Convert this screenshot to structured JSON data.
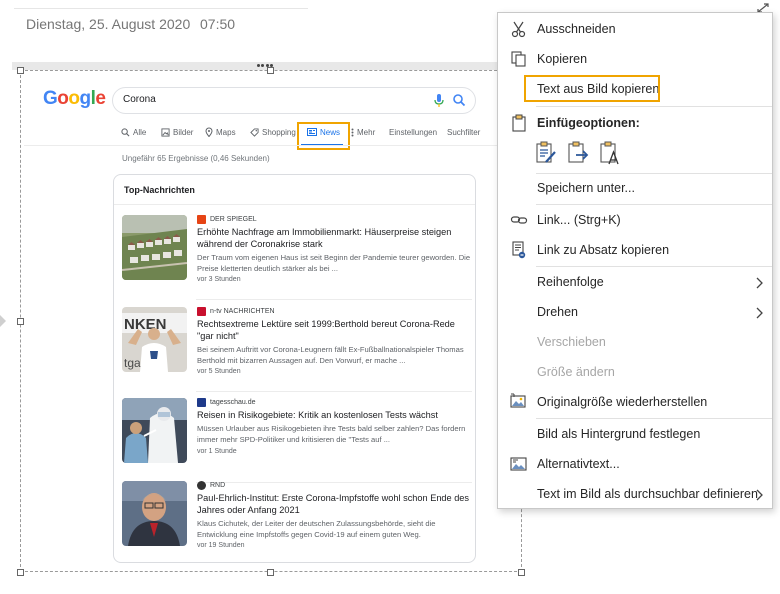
{
  "note": {
    "date": "Dienstag, 25. August 2020",
    "time": "07:50"
  },
  "google": {
    "logo_letters": [
      {
        "ch": "G",
        "color": "#4285F4"
      },
      {
        "ch": "o",
        "color": "#EA4335"
      },
      {
        "ch": "o",
        "color": "#FBBC05"
      },
      {
        "ch": "g",
        "color": "#4285F4"
      },
      {
        "ch": "l",
        "color": "#34A853"
      },
      {
        "ch": "e",
        "color": "#EA4335"
      }
    ],
    "query": "Corona",
    "tabs": [
      {
        "label": "Alle",
        "icon": "search-icon"
      },
      {
        "label": "Bilder",
        "icon": "image-icon"
      },
      {
        "label": "Maps",
        "icon": "pin-icon"
      },
      {
        "label": "Shopping",
        "icon": "tag-icon"
      },
      {
        "label": "News",
        "icon": "newspaper-icon",
        "active": true
      },
      {
        "label": "Mehr",
        "icon": "more-vert-icon"
      },
      {
        "label": "Einstellungen"
      },
      {
        "label": "Suchfilter"
      }
    ],
    "result_count": "Ungefähr 65 Ergebnisse (0,46 Sekunden)",
    "top_news": {
      "title": "Top-Nachrichten",
      "stories": [
        {
          "source": "DER SPIEGEL",
          "source_color": "#e64415",
          "headline": "Erhöhte Nachfrage am Immobilienmarkt: Häuserpreise steigen während der Coronakrise stark",
          "snippet": "Der Traum vom eigenen Haus ist seit Beginn der Pandemie teurer geworden. Die Preise kletterten deutlich stärker als bei ...",
          "age": "vor 3 Stunden"
        },
        {
          "source": "n-tv NACHRICHTEN",
          "source_color": "#c8102e",
          "headline": "Rechtsextreme Lektüre seit 1999:Berthold bereut Corona-Rede \"gar nicht\"",
          "snippet": "Bei seinem Auftritt vor Corona-Leugnern fällt Ex-Fußballnationalspieler Thomas Berthold mit bizarren Aussagen auf. Den Vorwurf, er mache ...",
          "age": "vor 5 Stunden"
        },
        {
          "source": "tagesschau.de",
          "source_color": "#1e3a8a",
          "headline": "Reisen in Risikogebiete: Kritik an kostenlosen Tests wächst",
          "snippet": "Müssen Urlauber aus Risikogebieten ihre Tests bald selber zahlen? Das fordern immer mehr SPD-Politiker und kritisieren die \"Tests auf ...",
          "age": "vor 1 Stunde"
        },
        {
          "source": "RND",
          "source_color": "#333333",
          "headline": "Paul-Ehrlich-Institut: Erste Corona-Impfstoffe wohl schon Ende des Jahres oder Anfang 2021",
          "snippet": "Klaus Cichutek, der Leiter der deutschen Zulassungsbehörde, sieht die Entwicklung eine Impfstoffs gegen Covid-19 auf einem guten Weg.",
          "age": "vor 19 Stunden"
        }
      ]
    }
  },
  "context_menu": {
    "cut": "Ausschneiden",
    "copy": "Kopieren",
    "copy_text": "Text aus Bild kopieren",
    "paste_options": "Einfügeoptionen:",
    "save_as": "Speichern unter...",
    "link": "Link... (Strg+K)",
    "copy_paragraph_link": "Link zu Absatz kopieren",
    "order": "Reihenfolge",
    "rotate": "Drehen",
    "move": "Verschieben",
    "resize": "Größe ändern",
    "restore_size": "Originalgröße wiederherstellen",
    "set_background": "Bild als Hintergrund festlegen",
    "alt_text": "Alternativtext...",
    "make_searchable": "Text im Bild als durchsuchbar definieren"
  },
  "colors": {
    "accent_highlight": "#f0a400",
    "google_blue": "#1a73e8",
    "icon_blue": "#2b579a"
  }
}
